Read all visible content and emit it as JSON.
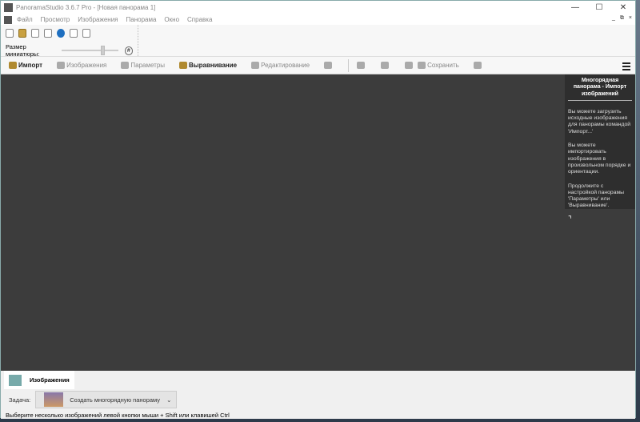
{
  "title": "PanoramaStudio 3.6.7 Pro - [Новая панорама 1]",
  "window_controls": {
    "minimize": "—",
    "maximize": "☐",
    "close": "✕"
  },
  "mdi_controls": {
    "minimize": "_",
    "restore": "⧉",
    "close": "×"
  },
  "menu": [
    "Файл",
    "Просмотр",
    "Изображения",
    "Панорама",
    "Окно",
    "Справка"
  ],
  "thumb_size_label": "Размер миниатюры:",
  "thumb_size_value": 0.7,
  "fit_label": "#",
  "toolbar": {
    "import": "Импорт",
    "images": "Изображения",
    "params": "Параметры",
    "align": "Выравнивание",
    "edit": "Редактирование",
    "save": "Сохранить"
  },
  "help": {
    "title": "Многорядная панорама - Импорт изображений",
    "p1": "Вы можете загрузить исходные изображения для панорамы командой 'Импорт...'",
    "p2": "Вы можете импортировать изображения в произвольном порядке и ориентации.",
    "p3": "Продолжите с настройкой панорамы 'Параметры' или 'Выравнивание'.",
    "collapse": "⌝"
  },
  "bottom": {
    "tab": "Изображения",
    "task_label": "Задача:",
    "task_value": "Создать многорядную панораму",
    "status": "Выберите несколько изображений левой кнопки мыши + Shift или клавишей Ctrl"
  }
}
